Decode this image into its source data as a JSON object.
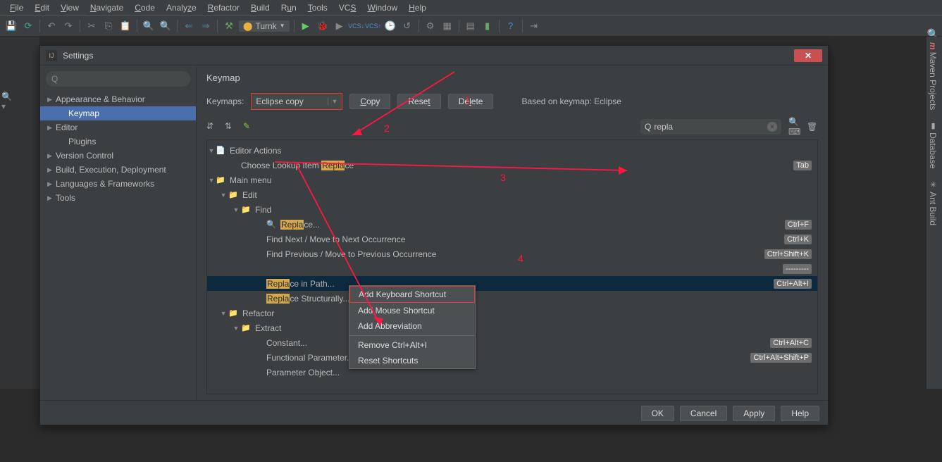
{
  "menu": [
    "File",
    "Edit",
    "View",
    "Navigate",
    "Code",
    "Analyze",
    "Refactor",
    "Build",
    "Run",
    "Tools",
    "VCS",
    "Window",
    "Help"
  ],
  "menu_underline": [
    0,
    0,
    0,
    0,
    0,
    4,
    1,
    0,
    0,
    0,
    2,
    0,
    0
  ],
  "runconfig": "Turnk",
  "dialog": {
    "title": "Settings",
    "categories": [
      {
        "label": "Appearance & Behavior",
        "arrow": true
      },
      {
        "label": "Keymap",
        "arrow": false,
        "sub": true,
        "sel": true
      },
      {
        "label": "Editor",
        "arrow": true
      },
      {
        "label": "Plugins",
        "arrow": false,
        "sub": true
      },
      {
        "label": "Version Control",
        "arrow": true
      },
      {
        "label": "Build, Execution, Deployment",
        "arrow": true
      },
      {
        "label": "Languages & Frameworks",
        "arrow": true
      },
      {
        "label": "Tools",
        "arrow": true
      }
    ],
    "heading": "Keymap",
    "keymaps_label": "Keymaps:",
    "keymaps_value": "Eclipse copy",
    "copy": "Copy",
    "reset": "Reset",
    "delete": "Delete",
    "based": "Based on keymap: Eclipse",
    "search_value": "repla",
    "tree": [
      {
        "depth": 0,
        "exp": "▼",
        "icon": "📄",
        "label": "Editor Actions",
        "cls": "blue"
      },
      {
        "depth": 2,
        "label_pre": "Choose Lookup Item ",
        "label_hl": "Repla",
        "label_post": "ce",
        "shortcut": "Tab"
      },
      {
        "depth": 0,
        "exp": "▼",
        "icon": "📁",
        "label": "Main menu",
        "cls": "blue"
      },
      {
        "depth": 1,
        "exp": "▼",
        "icon": "📁",
        "label": "Edit",
        "cls": "fld"
      },
      {
        "depth": 2,
        "exp": "▼",
        "icon": "📁",
        "label": "Find",
        "cls": "blue"
      },
      {
        "depth": 4,
        "icon": "🔍",
        "label_hl": "Repla",
        "label_post": "ce...",
        "shortcut": "Ctrl+F"
      },
      {
        "depth": 4,
        "label": "Find Next / Move to Next Occurrence",
        "shortcut": "Ctrl+K"
      },
      {
        "depth": 4,
        "label": "Find Previous / Move to Previous Occurrence",
        "shortcut": "Ctrl+Shift+K"
      },
      {
        "depth": 4,
        "label": "",
        "shortcut": "---------"
      },
      {
        "depth": 4,
        "label_hl": "Repla",
        "label_post": "ce in Path...",
        "shortcut": "Ctrl+Alt+I",
        "sel": true
      },
      {
        "depth": 4,
        "label_hl": "Repla",
        "label_post": "ce Structurally..."
      },
      {
        "depth": 1,
        "exp": "▼",
        "icon": "📁",
        "label": "Refactor",
        "cls": "fld"
      },
      {
        "depth": 2,
        "exp": "▼",
        "icon": "📁",
        "label": "Extract",
        "cls": "fld"
      },
      {
        "depth": 4,
        "label": "Constant...",
        "shortcut": "Ctrl+Alt+C"
      },
      {
        "depth": 4,
        "label": "Functional Parameter...",
        "shortcut": "Ctrl+Alt+Shift+P"
      },
      {
        "depth": 4,
        "label": "Parameter Object..."
      }
    ],
    "ctx": [
      "Add Keyboard Shortcut",
      "Add Mouse Shortcut",
      "Add Abbreviation",
      "-",
      "Remove Ctrl+Alt+I",
      "Reset Shortcuts"
    ],
    "ok": "OK",
    "cancel": "Cancel",
    "apply": "Apply",
    "help": "Help"
  },
  "annotations": {
    "a1": "1",
    "a2": "2",
    "a3": "3",
    "a4": "4"
  },
  "right_tabs": [
    "Maven Projects",
    "Database",
    "Ant Build"
  ]
}
